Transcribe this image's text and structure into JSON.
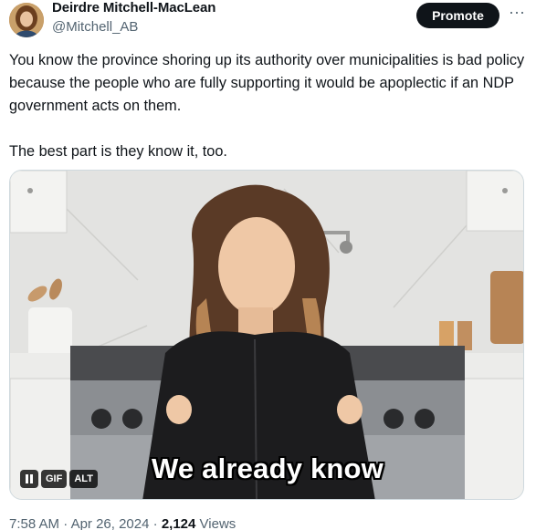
{
  "author": {
    "display_name": "Deirdre Mitchell-MacLean",
    "handle": "@Mitchell_AB",
    "avatar_icon": "profile-photo"
  },
  "promote_label": "Promote",
  "more_label": "···",
  "tweet": {
    "paragraphs": [
      "You know the province shoring up its authority over municipalities is bad policy because the people who are fully supporting it would be apoplectic if an NDP government acts on them.",
      "The best part is they know it, too."
    ]
  },
  "media": {
    "type": "gif",
    "caption": "We already know",
    "controls": {
      "pause_icon": "pause-icon",
      "gif_label": "GIF",
      "alt_label": "ALT"
    }
  },
  "meta": {
    "time": "7:58 AM",
    "separator": "·",
    "date": "Apr 26, 2024",
    "views_count": "2,124",
    "views_label": "Views"
  },
  "colors": {
    "text": "#0f1419",
    "secondary": "#536471",
    "button_bg": "#0f1419",
    "border": "#cfd9de"
  }
}
